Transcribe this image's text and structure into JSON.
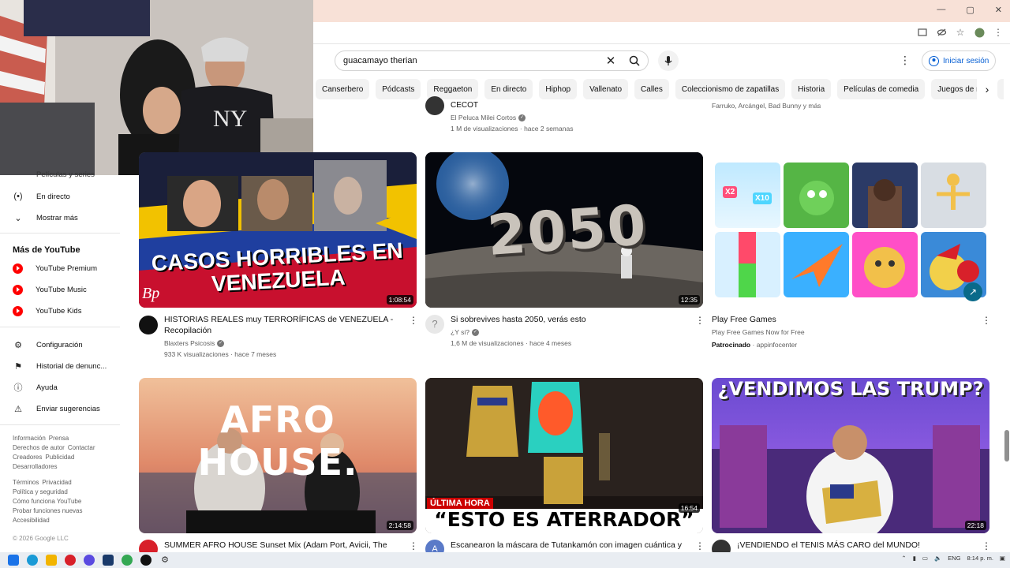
{
  "browser": {
    "window_controls": [
      "—",
      "▢",
      "✕"
    ]
  },
  "search": {
    "query": "guacamayo therian",
    "signin_label": "Iniciar sesión"
  },
  "chips": [
    "Canserbero",
    "Pódcasts",
    "Reggaeton",
    "En directo",
    "Hiphop",
    "Vallenato",
    "Calles",
    "Coleccionismo de zapatillas",
    "Historia",
    "Películas de comedia",
    "Juegos de rol",
    "T"
  ],
  "sidebar": {
    "partial_item": "Películas y series",
    "items": [
      {
        "label": "En directo",
        "icon": "live-icon"
      },
      {
        "label": "Mostrar más",
        "icon": "chevron-down-icon"
      }
    ],
    "more_heading": "Más de YouTube",
    "more_items": [
      "YouTube Premium",
      "YouTube Music",
      "YouTube Kids"
    ],
    "settings_items": [
      {
        "label": "Configuración",
        "icon": "gear-icon"
      },
      {
        "label": "Historial de denunc...",
        "icon": "flag-icon"
      },
      {
        "label": "Ayuda",
        "icon": "help-icon"
      },
      {
        "label": "Enviar sugerencias",
        "icon": "feedback-icon"
      }
    ],
    "footer_lines": [
      [
        "Información",
        "Prensa"
      ],
      [
        "Derechos de autor",
        "Contactar"
      ],
      [
        "Creadores",
        "Publicidad"
      ],
      [
        "Desarrolladores"
      ],
      [
        "Términos",
        "Privacidad"
      ],
      [
        "Política y seguridad"
      ],
      [
        "Cómo funciona YouTube"
      ],
      [
        "Probar funciones nuevas"
      ],
      [
        "Accesibilidad"
      ]
    ],
    "copyright": "© 2026 Google LLC"
  },
  "top_partial": {
    "left_title": "CECOT",
    "left_channel": "El Peluca Milei Cortos",
    "left_meta": "1 M de visualizaciones · hace 2 semanas",
    "right_meta": "Farruko, Arcángel, Bad Bunny y más"
  },
  "videos": [
    {
      "title": "HISTORIAS REALES muy TERRORÍFICAS de VENEZUELA - Recopilación",
      "channel": "Blaxters Psicosis",
      "meta": "933 K visualizaciones · hace 7 meses",
      "duration": "1:08:54",
      "thumb_text": "CASOS HORRIBLES EN VENEZUELA",
      "thumb_mark": "Bp"
    },
    {
      "title": "Si sobrevives hasta 2050, verás esto",
      "channel": "¿Y si?",
      "meta": "1,6 M de visualizaciones · hace 4 meses",
      "duration": "12:35",
      "thumb_text": "2050"
    },
    {
      "title": "Play Free Games",
      "channel": "Play Free Games Now for Free",
      "meta_sponsored": "Patrocinado",
      "meta_source": "appinfocenter"
    },
    {
      "title": "SUMMER AFRO HOUSE Sunset Mix (Adam Port, Avicii, The",
      "duration": "2:14:58",
      "thumb_text": "AFRO HOUSE."
    },
    {
      "title": "Escanearon la máscara de Tutankamón con imagen cuántica y",
      "duration": "16:54",
      "thumb_tag": "ÚLTIMA HORA",
      "thumb_text": "“ESTO ES ATERRADOR”",
      "avatar_letter": "A"
    },
    {
      "title": "¡VENDIENDO el TENIS MÁS CARO del MUNDO!",
      "duration": "22:18",
      "thumb_text": "¿VENDIMOS LAS TRUMP?"
    }
  ],
  "ad_tiles": [
    "X2",
    "X10"
  ],
  "tray": {
    "lang": "ENG",
    "time": "8:14 p. m."
  },
  "colors": {
    "accent_blue": "#065fd4",
    "brand_red": "#ff0000",
    "titlebar": "#f8e1d7"
  }
}
